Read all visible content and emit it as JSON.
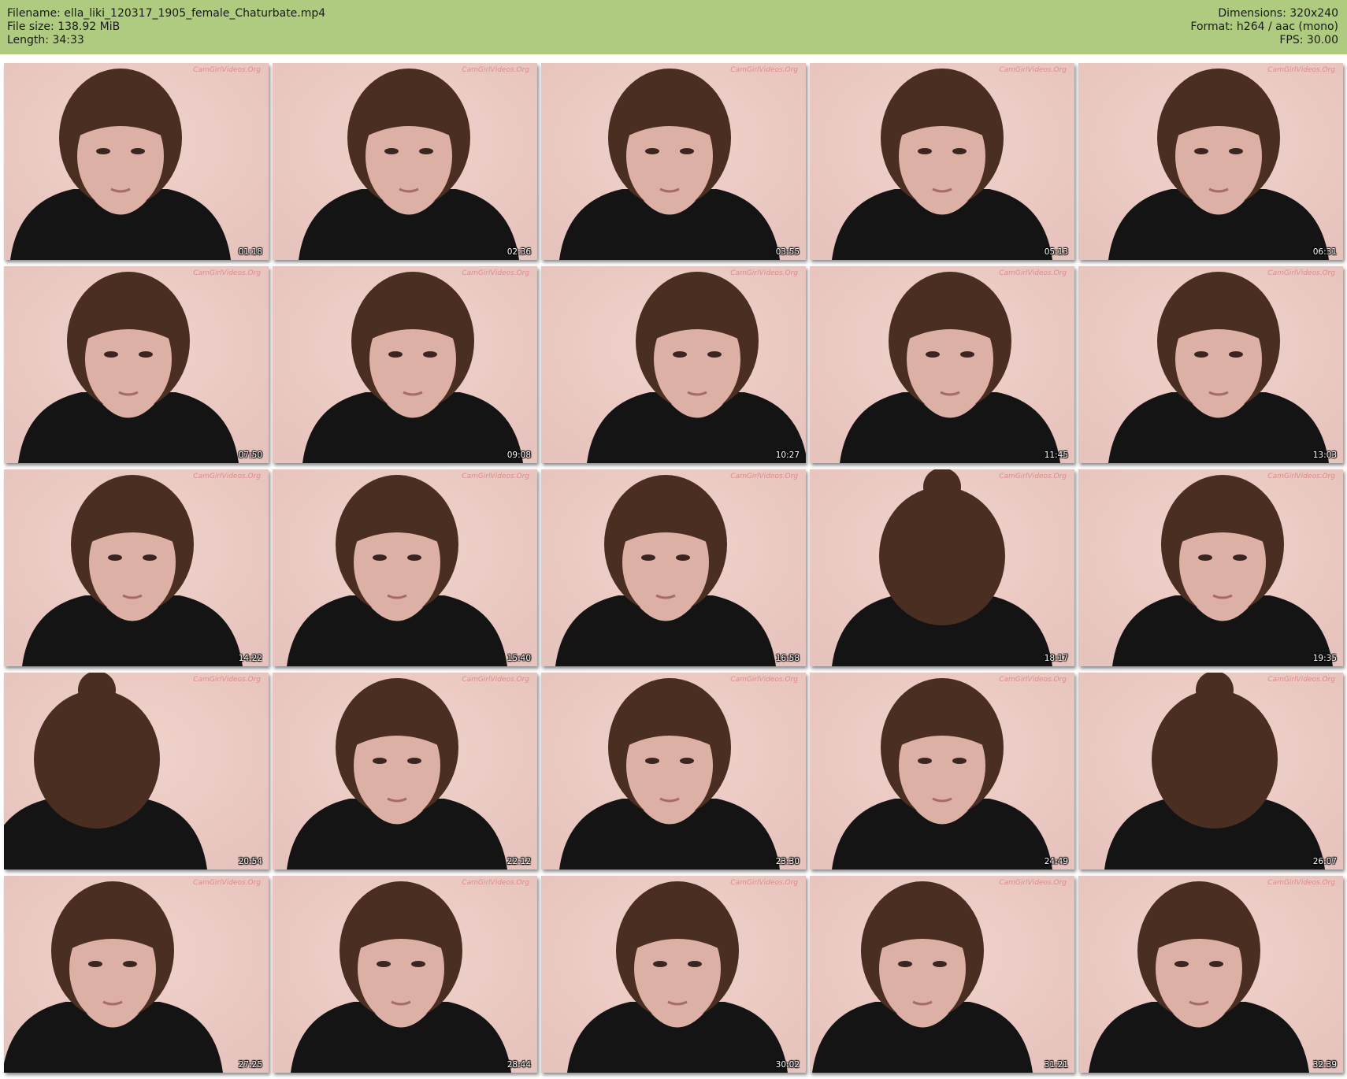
{
  "header": {
    "filename": "Filename: ella_liki_120317_1905_female_Chaturbate.mp4",
    "filesize": "File size: 138.92 MiB",
    "length": "Length: 34:33",
    "dimensions": "Dimensions: 320x240",
    "format": "Format: h264 / aac (mono)",
    "fps": "FPS: 30.00"
  },
  "colors": {
    "header_bg": "#afcb80",
    "wall": "#e7c3bd",
    "shirt": "#141414",
    "hair": "#4a2e22",
    "skin": "#dcb0a5"
  },
  "watermark": "CamGirlVideos.Org",
  "thumbs": [
    {
      "time": "01:18"
    },
    {
      "time": "02:36"
    },
    {
      "time": "03:55"
    },
    {
      "time": "05:13"
    },
    {
      "time": "06:31"
    },
    {
      "time": "07:50"
    },
    {
      "time": "09:08"
    },
    {
      "time": "10:27"
    },
    {
      "time": "11:45"
    },
    {
      "time": "13:03"
    },
    {
      "time": "14:22"
    },
    {
      "time": "15:40"
    },
    {
      "time": "16:58"
    },
    {
      "time": "18:17"
    },
    {
      "time": "19:35"
    },
    {
      "time": "20:54"
    },
    {
      "time": "22:12"
    },
    {
      "time": "23:30"
    },
    {
      "time": "24:49"
    },
    {
      "time": "26:07"
    },
    {
      "time": "27:25"
    },
    {
      "time": "28:44"
    },
    {
      "time": "30:02"
    },
    {
      "time": "31:21"
    },
    {
      "time": "32:39"
    }
  ]
}
